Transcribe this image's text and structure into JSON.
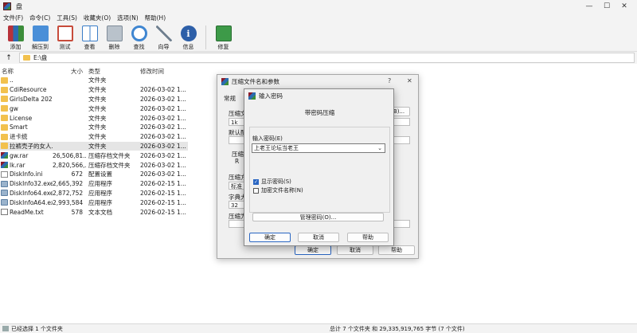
{
  "window": {
    "title": "盘",
    "minimize": "—",
    "maximize": "☐",
    "close": "✕"
  },
  "menu": [
    "文件(F)",
    "命令(C)",
    "工具(S)",
    "收藏夹(O)",
    "选项(N)",
    "帮助(H)"
  ],
  "toolbar": [
    {
      "label": "添加",
      "icon": "add-archive-icon",
      "color": "#b7323a"
    },
    {
      "label": "解压到",
      "icon": "extract-folder-icon",
      "color": "#4a8fd8"
    },
    {
      "label": "测试",
      "icon": "test-icon",
      "color": "#c74b3b"
    },
    {
      "label": "查看",
      "icon": "view-book-icon",
      "color": "#3a7dc8"
    },
    {
      "label": "删除",
      "icon": "trash-icon",
      "color": "#7f8c99"
    },
    {
      "label": "查找",
      "icon": "magnifier-icon",
      "color": "#3f86d1"
    },
    {
      "label": "向导",
      "icon": "wand-icon",
      "color": "#6f7f8f"
    },
    {
      "label": "信息",
      "icon": "info-icon",
      "color": "#2d5fa8"
    },
    {
      "label": "修复",
      "icon": "repair-book-icon",
      "color": "#3d9a48"
    }
  ],
  "address": {
    "up": "↑",
    "path": "E:\\盘"
  },
  "columns": {
    "name": "名称",
    "size": "大小",
    "type": "类型",
    "date": "修改时间"
  },
  "files": [
    {
      "name": "..",
      "size": "",
      "type": "文件夹",
      "date": "",
      "kind": "folder"
    },
    {
      "name": "CdiResource",
      "size": "",
      "type": "文件夹",
      "date": "2026-03-02 1...",
      "kind": "folder"
    },
    {
      "name": "GirlsDelta 202...",
      "size": "",
      "type": "文件夹",
      "date": "2026-03-02 1...",
      "kind": "folder"
    },
    {
      "name": "gw",
      "size": "",
      "type": "文件夹",
      "date": "2026-03-02 1...",
      "kind": "folder"
    },
    {
      "name": "License",
      "size": "",
      "type": "文件夹",
      "date": "2026-03-02 1...",
      "kind": "folder"
    },
    {
      "name": "Smart",
      "size": "",
      "type": "文件夹",
      "date": "2026-03-02 1...",
      "kind": "folder"
    },
    {
      "name": "进卡统",
      "size": "",
      "type": "文件夹",
      "date": "2026-03-02 1...",
      "kind": "folder"
    },
    {
      "name": "拉裤壳子的女人...",
      "size": "",
      "type": "文件夹",
      "date": "2026-03-02 1...",
      "kind": "folder",
      "selected": true
    },
    {
      "name": "gw.rar",
      "size": "26,506,81...",
      "type": "压缩存档文件夹",
      "date": "2026-03-02 1...",
      "kind": "rar"
    },
    {
      "name": "lk.rar",
      "size": "2,820,566,...",
      "type": "压缩存档文件夹",
      "date": "2026-03-02 1...",
      "kind": "rar"
    },
    {
      "name": "DiskInfo.ini",
      "size": "672",
      "type": "配置设置",
      "date": "2026-03-02 1...",
      "kind": "ini"
    },
    {
      "name": "DiskInfo32.exe",
      "size": "2,665,392",
      "type": "应用程序",
      "date": "2026-02-15 1...",
      "kind": "exe"
    },
    {
      "name": "DiskInfo64.exe",
      "size": "2,872,752",
      "type": "应用程序",
      "date": "2026-02-15 1...",
      "kind": "exe"
    },
    {
      "name": "DiskInfoA64.exe",
      "size": "2,993,584",
      "type": "应用程序",
      "date": "2026-02-15 1...",
      "kind": "exe"
    },
    {
      "name": "ReadMe.txt",
      "size": "578",
      "type": "文本文档",
      "date": "2026-02-15 1...",
      "kind": "txt"
    }
  ],
  "status": {
    "left": "已经选择 1 个文件夹",
    "right": "总计 7 个文件夹 和 29,335,919,765 字节 (7 个文件)"
  },
  "back_dialog": {
    "title": "压缩文件名和参数",
    "help": "?",
    "close": "✕",
    "tab": "常规",
    "labels": [
      "压缩文",
      "默认配",
      "压缩",
      "压缩方",
      "字典大",
      "压缩为"
    ],
    "field_values": [
      "1k",
      "",
      "",
      "标准",
      "32"
    ],
    "browse_suffix": "B)...",
    "radio_label": "R",
    "ok": "确定",
    "cancel": "取消",
    "help_btn": "帮助"
  },
  "front_dialog": {
    "title": "输入密码",
    "subtitle": "带密码压缩",
    "pw_label": "输入密码(E)",
    "pw_value": "上老王论坛当老王",
    "show_pw": "显示密码(S)",
    "show_pw_checked": true,
    "encrypt_names": "加密文件名称(N)",
    "encrypt_names_checked": false,
    "manage": "管理密码(O)...",
    "ok": "确定",
    "cancel": "取消",
    "help": "帮助"
  }
}
